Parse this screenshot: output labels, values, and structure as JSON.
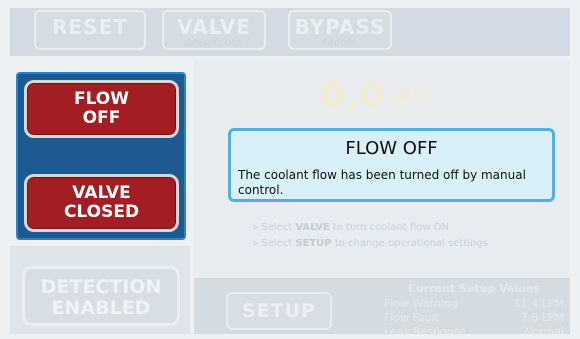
{
  "top_bar": {
    "reset_label": "RESET",
    "valve_label": "VALVE",
    "valve_sub": "OPEN/CLOSE",
    "bypass_label": "BYPASS",
    "bypass_sub": "ON/OFF"
  },
  "status_panel": {
    "flow_line1": "FLOW",
    "flow_line2": "OFF",
    "valve_line1": "VALVE",
    "valve_line2": "CLOSED"
  },
  "detection": {
    "line1": "DETECTION",
    "line2": "ENABLED"
  },
  "flow_readout": {
    "value": "0.0",
    "unit": "LPM"
  },
  "hints": {
    "line1_pre": "» Select ",
    "line1_key": "VALVE",
    "line1_post": " to turn coolant flow ON",
    "line2_pre": "» Select ",
    "line2_key": "SETUP",
    "line2_post": " to change operational settings"
  },
  "setup_button_label": "SETUP",
  "setup_values": {
    "title": "Current Setup Values",
    "rows": [
      {
        "label": "Flow Warning",
        "value": "11.4 LPM"
      },
      {
        "label": "Flow Fault",
        "value": "7.6 LPM"
      },
      {
        "label": "Leak Response",
        "value": "Normal"
      }
    ]
  },
  "popup": {
    "title": "FLOW OFF",
    "message": "The coolant flow has been turned off by manual control."
  }
}
